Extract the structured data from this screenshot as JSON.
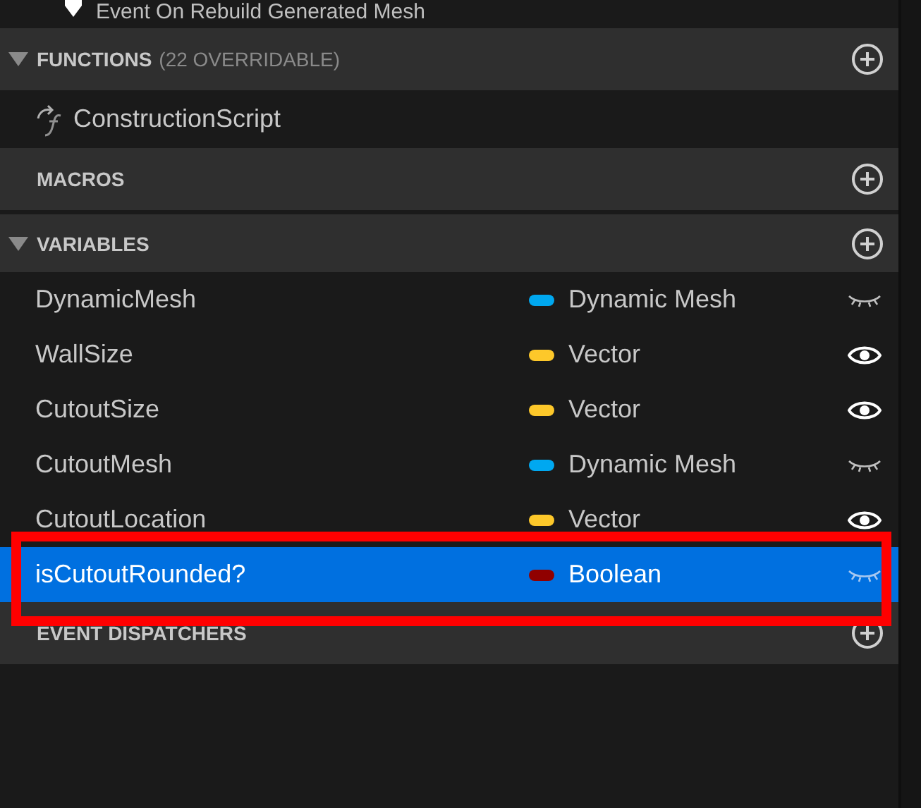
{
  "top_item": {
    "label": "Event On Rebuild Generated Mesh"
  },
  "sections": [
    {
      "kind": "functions",
      "title": "FUNCTIONS",
      "note": "(22 OVERRIDABLE)",
      "expanded": true,
      "items": [
        {
          "label": "ConstructionScript"
        }
      ]
    },
    {
      "kind": "macros",
      "title": "MACROS"
    },
    {
      "kind": "variables",
      "title": "VARIABLES",
      "expanded": true,
      "variables": [
        {
          "name": "DynamicMesh",
          "type": "Dynamic Mesh",
          "color": "#00a8f0",
          "public": false,
          "selected": false,
          "highlighted": false
        },
        {
          "name": "WallSize",
          "type": "Vector",
          "color": "#fdc82a",
          "public": true,
          "selected": false,
          "highlighted": false
        },
        {
          "name": "CutoutSize",
          "type": "Vector",
          "color": "#fdc82a",
          "public": true,
          "selected": false,
          "highlighted": false
        },
        {
          "name": "CutoutMesh",
          "type": "Dynamic Mesh",
          "color": "#00a8f0",
          "public": false,
          "selected": false,
          "highlighted": false
        },
        {
          "name": "CutoutLocation",
          "type": "Vector",
          "color": "#fdc82a",
          "public": true,
          "selected": false,
          "highlighted": false
        },
        {
          "name": "isCutoutRounded?",
          "type": "Boolean",
          "color": "#900000",
          "public": false,
          "selected": true,
          "highlighted": true
        }
      ]
    },
    {
      "kind": "dispatchers",
      "title": "EVENT DISPATCHERS"
    }
  ]
}
